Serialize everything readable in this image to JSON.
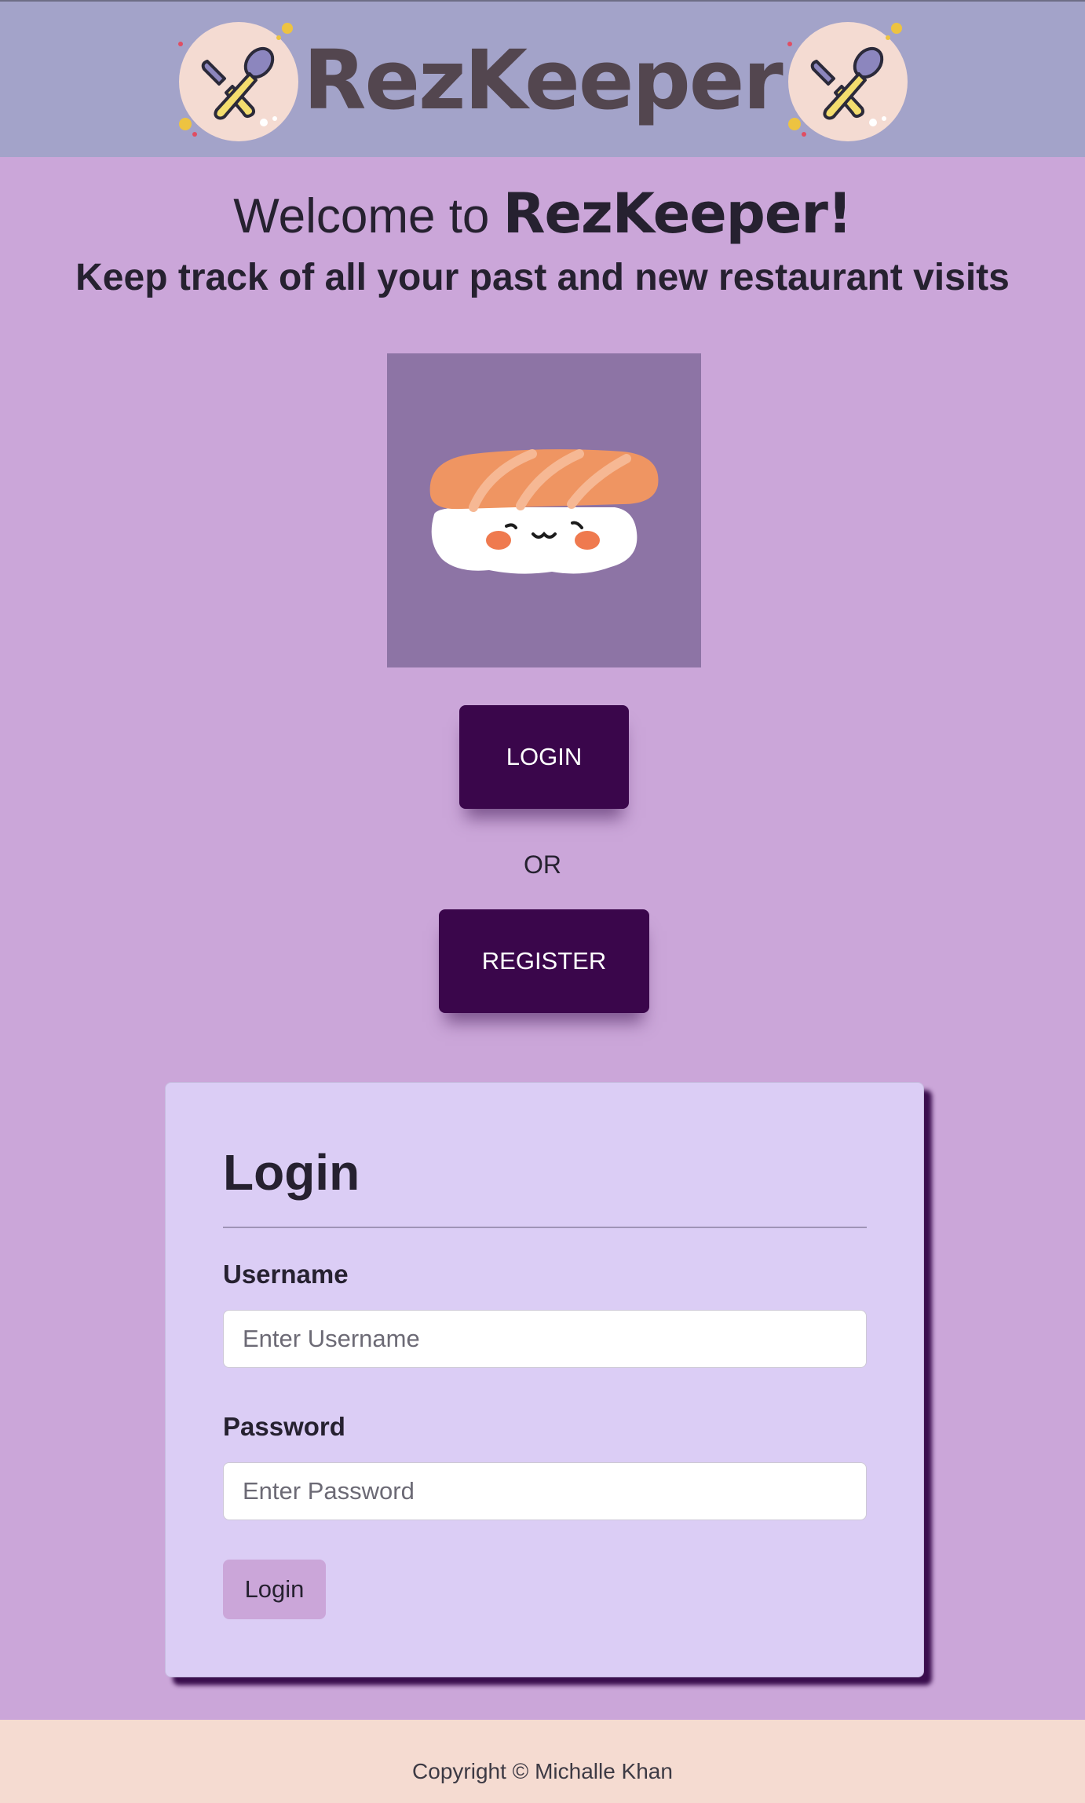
{
  "header": {
    "brand": "RezKeeper",
    "left_icon": "crossed-utensils-icon",
    "right_icon": "crossed-utensils-icon"
  },
  "welcome": {
    "prefix": "Welcome to",
    "brand": "RezKeeper!",
    "subtitle": "Keep track of all your past and new restaurant visits"
  },
  "hero": {
    "image": "sushi-illustration"
  },
  "actions": {
    "login_label": "LOGIN",
    "or_label": "OR",
    "register_label": "REGISTER"
  },
  "login_form": {
    "title": "Login",
    "username_label": "Username",
    "username_placeholder": "Enter Username",
    "username_value": "",
    "password_label": "Password",
    "password_placeholder": "Enter Password",
    "password_value": "",
    "submit_label": "Login"
  },
  "footer": {
    "copyright": "Copyright © Michalle Khan"
  },
  "colors": {
    "header_bg": "#a3a3c9",
    "page_bg": "#cba6d9",
    "button_dark": "#3a064b",
    "card_bg": "#dbcdf5",
    "footer_bg": "#f5dbd1"
  }
}
